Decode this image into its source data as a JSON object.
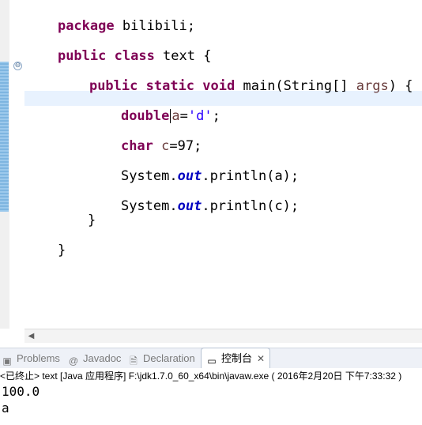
{
  "editor": {
    "lines": {
      "l1": {
        "kw": "package",
        "rest": " bilibili;"
      },
      "l2": {
        "kw1": "public",
        "kw2": "class",
        "rest": " text {"
      },
      "l3": {
        "kw1": "public",
        "kw2": "static",
        "kw3": "void",
        "rest": " main(String[] ",
        "arg": "args",
        "rest2": ") {"
      },
      "l4": {
        "kw": "double",
        "var": "a",
        "eq": "=",
        "str": "'d'",
        "end": ";"
      },
      "l5": {
        "kw": "char",
        "var": "c",
        "rest": "=97;"
      },
      "l6": {
        "pre": "System.",
        "field": "out",
        "post": ".println(a);"
      },
      "l7": {
        "pre": "System.",
        "field": "out",
        "post": ".println(c);"
      },
      "l8": {
        "text": "}"
      },
      "l9": {
        "text": "}"
      }
    }
  },
  "bottom_panel": {
    "tabs": [
      {
        "label": "Problems",
        "icon": "problems-icon"
      },
      {
        "label": "Javadoc",
        "icon": "at-icon"
      },
      {
        "label": "Declaration",
        "icon": "declaration-icon"
      },
      {
        "label": "控制台",
        "icon": "console-icon",
        "close": "✕"
      }
    ],
    "console": {
      "status": "<已终止> text [Java 应用程序] F:\\jdk1.7.0_60_x64\\bin\\javaw.exe ( 2016年2月20日 下午7:33:32 )",
      "output": [
        "100.0",
        "a"
      ]
    }
  }
}
